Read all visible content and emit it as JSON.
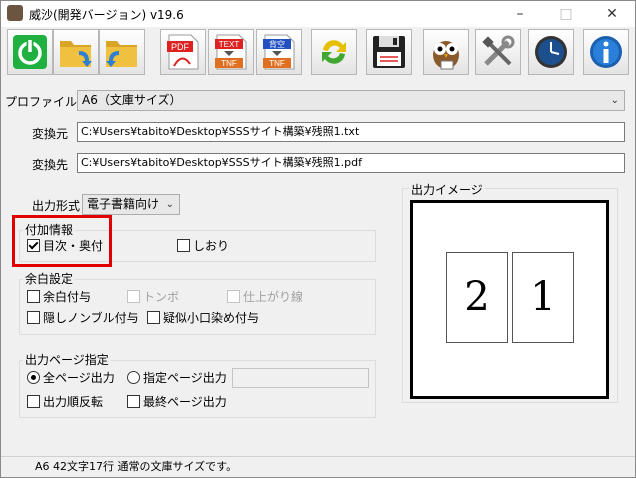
{
  "window": {
    "title": "威沙(開発バージョン) v19.6"
  },
  "toolbar": {
    "buttons": [
      {
        "icon": "power-icon"
      },
      {
        "icon": "folder-open-icon"
      },
      {
        "icon": "folder-back-icon"
      },
      {
        "icon": "pdf-icon",
        "text": "PDF"
      },
      {
        "icon": "text-to-tnf-icon",
        "text": "TEXT",
        "sub": "TNF"
      },
      {
        "icon": "blank-to-tnf-icon",
        "text": "背空",
        "sub": "TNF"
      },
      {
        "icon": "refresh-icon"
      },
      {
        "icon": "save-icon"
      },
      {
        "icon": "owl-icon"
      },
      {
        "icon": "tools-icon"
      },
      {
        "icon": "clock-icon"
      },
      {
        "icon": "info-icon"
      }
    ]
  },
  "profile": {
    "label": "プロファイル",
    "value": "A6（文庫サイズ）"
  },
  "source": {
    "label": "変換元",
    "value": "C:¥Users¥tabito¥Desktop¥SSSサイト構築¥残照1.txt"
  },
  "dest": {
    "label": "変換先",
    "value": "C:¥Users¥tabito¥Desktop¥SSSサイト構築¥残照1.pdf"
  },
  "output_format": {
    "label": "出力形式",
    "value": "電子書籍向け"
  },
  "extra_info": {
    "label": "付加情報",
    "toc": {
      "label": "目次・奥付",
      "checked": true
    },
    "bookmark": {
      "label": "しおり",
      "checked": false
    }
  },
  "margin": {
    "label": "余白設定",
    "add_margin": {
      "label": "余白付与",
      "checked": false
    },
    "tombo": {
      "label": "トンボ",
      "checked": false
    },
    "finish_line": {
      "label": "仕上がり線",
      "checked": false
    },
    "hidden_nombre": {
      "label": "隠しノンブル付与",
      "checked": false
    },
    "pseudo_edge": {
      "label": "疑似小口染め付与",
      "checked": false
    }
  },
  "output_pages": {
    "label": "出力ページ指定",
    "all": {
      "label": "全ページ出力",
      "selected": true
    },
    "specified": {
      "label": "指定ページ出力",
      "selected": false,
      "value": ""
    },
    "reverse": {
      "label": "出力順反転",
      "checked": false
    },
    "last": {
      "label": "最終ページ出力",
      "checked": false
    }
  },
  "preview": {
    "label": "出力イメージ",
    "left_page": "2",
    "right_page": "1"
  },
  "status": {
    "text": "A6 42文字17行 通常の文庫サイズです。"
  },
  "colors": {
    "highlight": "#e00000",
    "accent_green": "#20b040",
    "folder": "#e0b030"
  }
}
